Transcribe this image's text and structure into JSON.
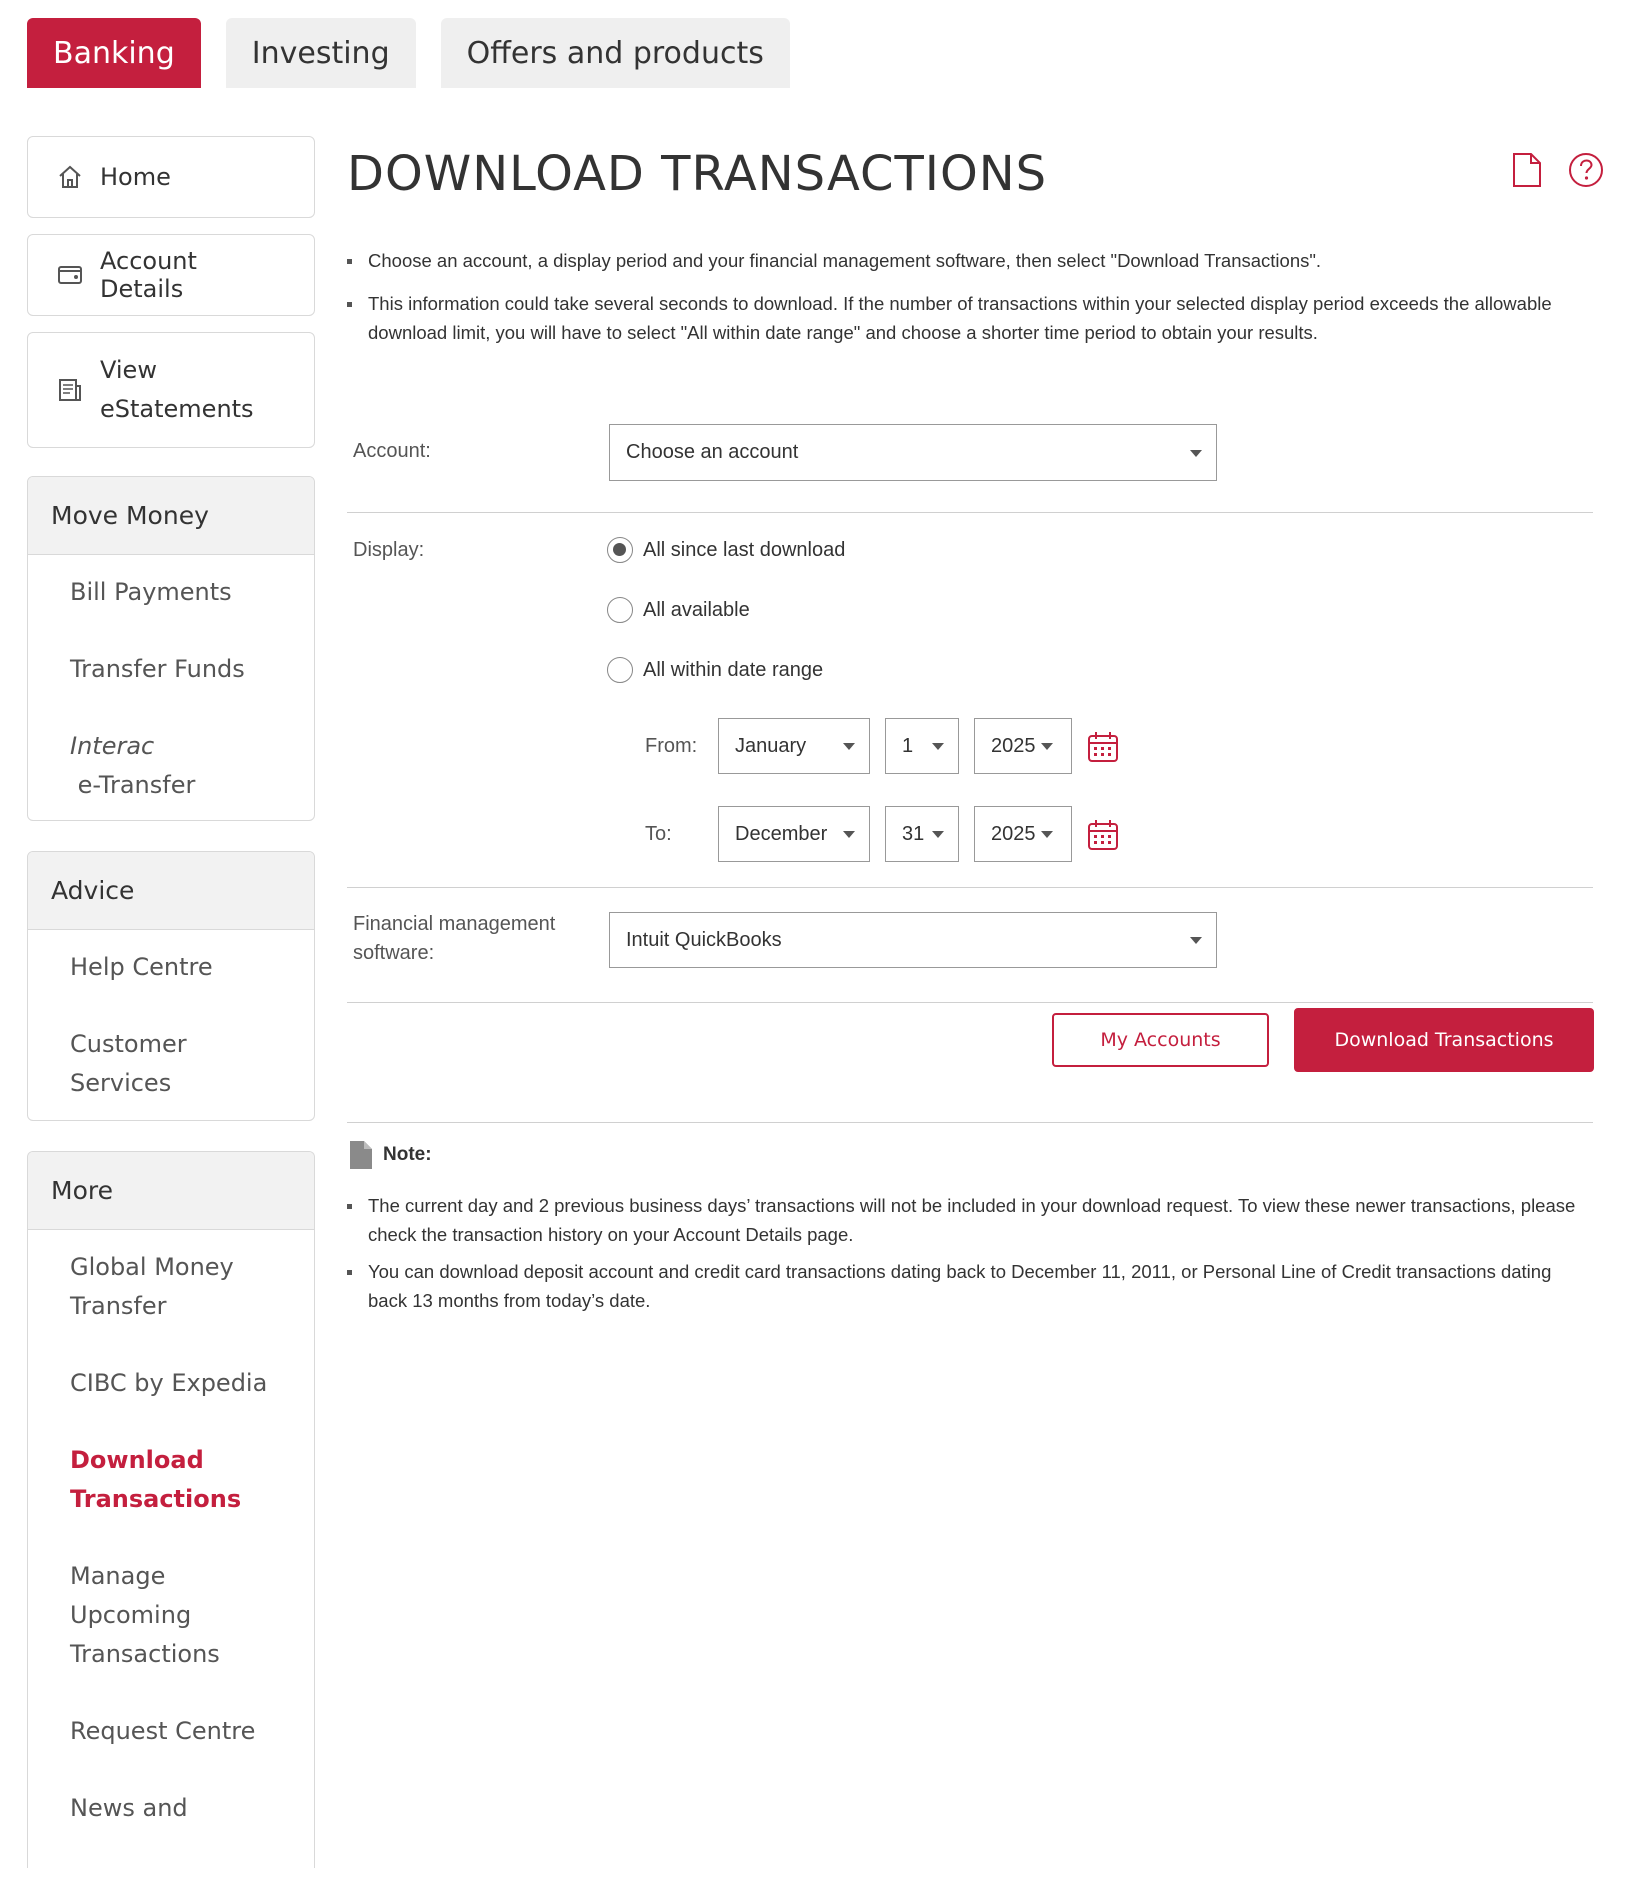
{
  "top_tabs": [
    {
      "label": "Banking",
      "active": true
    },
    {
      "label": "Investing",
      "active": false
    },
    {
      "label": "Offers and products",
      "active": false
    }
  ],
  "sidebar": {
    "links": {
      "home": "Home",
      "account_details": "Account Details",
      "view_estatements_line1": "View",
      "view_estatements_line2": "eStatements"
    },
    "move_money": {
      "heading": "Move Money",
      "items": {
        "bill_payments": "Bill Payments",
        "transfer_funds": "Transfer Funds",
        "interac_brand": "Interac",
        "interac_rest": " e-Transfer"
      }
    },
    "advice": {
      "heading": "Advice",
      "items": {
        "help_centre": "Help Centre",
        "customer_services": "Customer Services"
      }
    },
    "more": {
      "heading": "More",
      "items": {
        "global_money_l1": "Global Money",
        "global_money_l2": "Transfer",
        "expedia": "CIBC by Expedia",
        "download_l1": "Download",
        "download_l2": "Transactions",
        "manage_l1": "Manage Upcoming",
        "manage_l2": "Transactions",
        "request_centre": "Request Centre",
        "news_l1": "News and"
      }
    },
    "active_item": "Download Transactions"
  },
  "page": {
    "title": "DOWNLOAD TRANSACTIONS",
    "icons": {
      "document": "document-icon",
      "help": "help-circle-icon"
    },
    "intro": [
      "Choose an account, a display period and your financial management software, then select \"Download Transactions\".",
      "This information could take several seconds to download. If the number of transactions within your selected display period exceeds the allowable download limit, you will have to select \"All within date range\" and choose a shorter time period to obtain your results."
    ]
  },
  "form": {
    "account_label": "Account:",
    "account_value": "Choose an account",
    "display_label": "Display:",
    "display_options": {
      "since_last": "All since last download",
      "all_available": "All available",
      "date_range": "All within date range"
    },
    "selected_display": "All since last download",
    "from_label": "From:",
    "from": {
      "month": "January",
      "day": "1",
      "year": "2025"
    },
    "to_label": "To:",
    "to": {
      "month": "December",
      "day": "31",
      "year": "2025"
    },
    "software_label_l1": "Financial management",
    "software_label_l2": "software:",
    "software_value": "Intuit QuickBooks"
  },
  "buttons": {
    "my_accounts": "My Accounts",
    "download": "Download Transactions"
  },
  "note": {
    "heading": "Note:",
    "items": [
      "The current day and 2 previous business days’ transactions will not be included in your download request. To view these newer transactions, please check the transaction history on your Account Details page.",
      "You can download deposit account and credit card transactions dating back to December 11, 2011, or Personal Line of Credit transactions dating back 13 months from today’s date."
    ]
  },
  "colors": {
    "brand": "#c41f3e",
    "text": "#333333",
    "muted": "#555555",
    "border": "#d9d9d9"
  }
}
